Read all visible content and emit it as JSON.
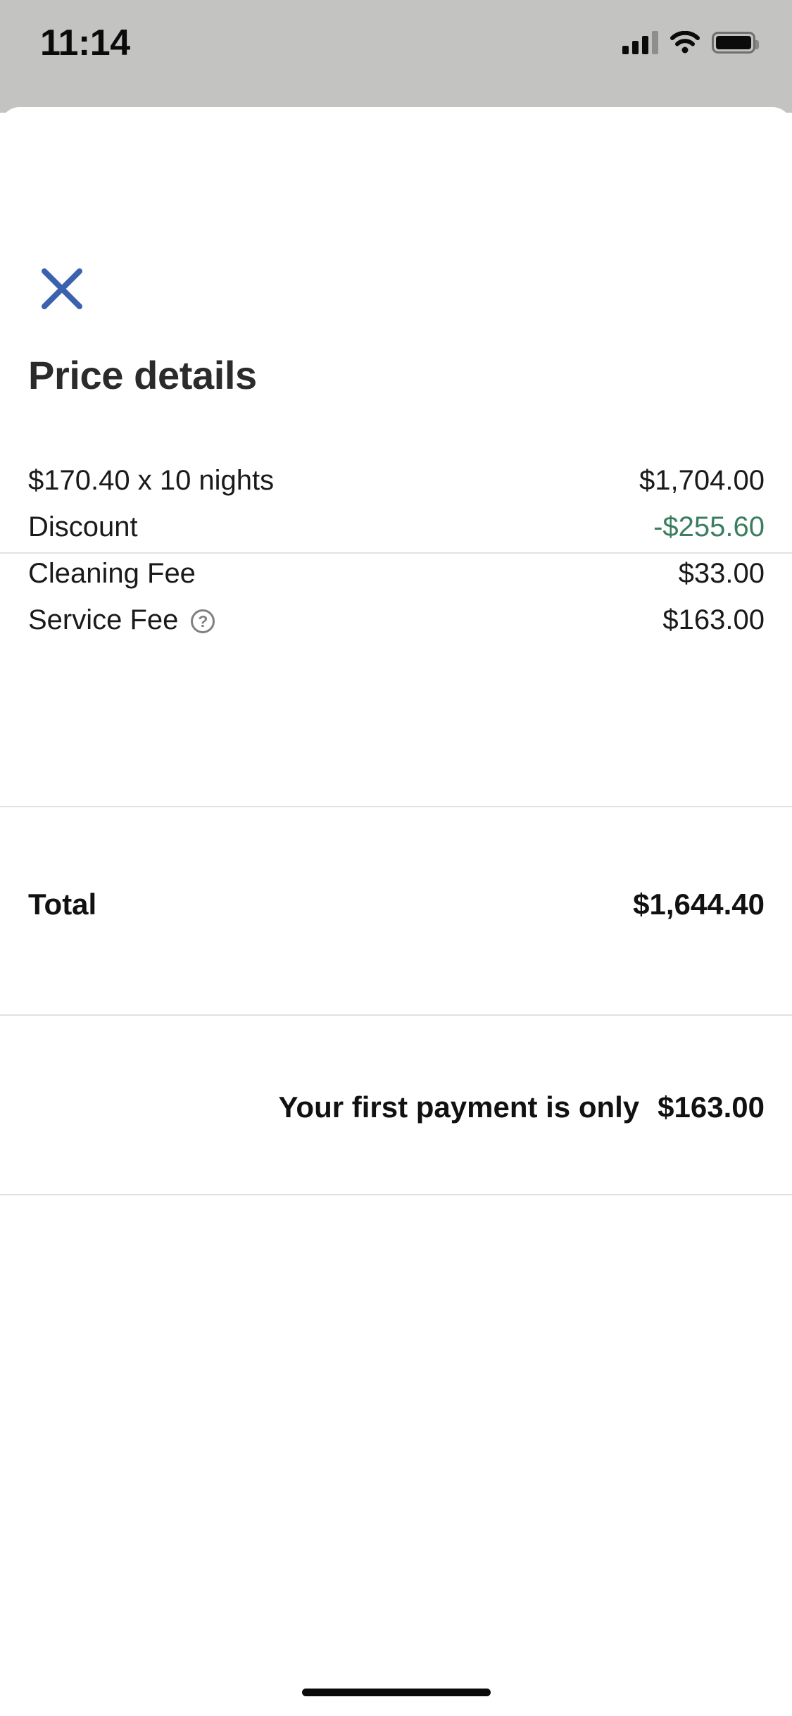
{
  "status_bar": {
    "time": "11:14",
    "signal_icon": "cellular-signal-icon",
    "wifi_icon": "wifi-icon",
    "battery_icon": "battery-full-icon"
  },
  "sheet": {
    "close_icon": "close-x-icon",
    "title": "Price details",
    "line_items": [
      {
        "label": "$170.40 x 10 nights",
        "value": "$1,704.00",
        "value_color": "#1a1a1a",
        "has_help_icon": false
      },
      {
        "label": "Discount",
        "value": "-$255.60",
        "value_color": "#3a7d60",
        "has_help_icon": false
      },
      {
        "label": "Cleaning Fee",
        "value": "$33.00",
        "value_color": "#1a1a1a",
        "has_help_icon": false
      },
      {
        "label": "Service Fee",
        "value": "$163.00",
        "value_color": "#1a1a1a",
        "has_help_icon": true,
        "help_icon": "help-circle-icon"
      }
    ],
    "total": {
      "label": "Total",
      "value": "$1,644.40"
    },
    "first_payment": {
      "label": "Your first payment is only",
      "value": "$163.00"
    }
  },
  "colors": {
    "accent_blue": "#3b62ae",
    "discount_green": "#3a7d60",
    "text_primary": "#1a1a1a",
    "divider": "#e2e2e2",
    "status_bar_bg": "#c3c3c1"
  },
  "home_indicator": "home-indicator"
}
